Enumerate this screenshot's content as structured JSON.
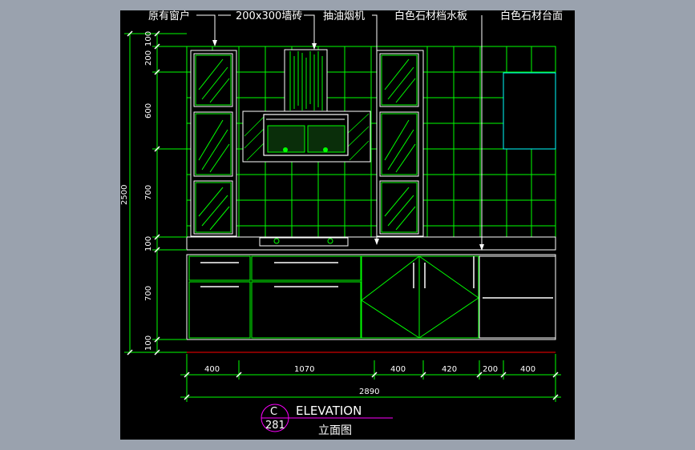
{
  "annotations": {
    "window": "原有窗户",
    "tile": "200x300墙砖",
    "hood": "抽油烟机",
    "splashback": "白色石材档水板",
    "countertop": "白色石材台面"
  },
  "dimensions": {
    "vertical": [
      "100",
      "200",
      "600",
      "700",
      "100",
      "700",
      "100"
    ],
    "total_height": "2500",
    "horizontal": [
      "400",
      "1070",
      "400",
      "420",
      "200",
      "400"
    ],
    "total_width": "2890"
  },
  "title_block": {
    "letter": "C",
    "number": "281",
    "title": "ELEVATION",
    "subtitle": "立面图"
  },
  "colors": {
    "background": "#000000",
    "outer": "#9aa2ae",
    "lines": "#00ff00",
    "white": "#ffffff",
    "cyan": "#00ffff",
    "magenta": "#ff00ff",
    "red": "#ff0000"
  }
}
